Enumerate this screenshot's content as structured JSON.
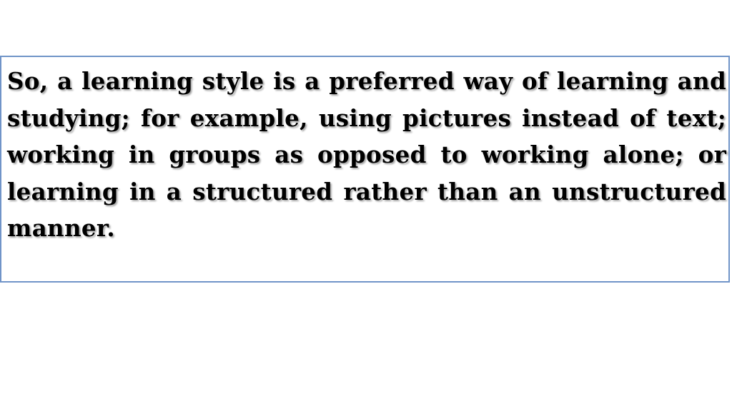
{
  "slide": {
    "paragraph": "So, a learning style is a preferred way of learning and studying; for example, using pictures instead of text; working in groups as opposed to working alone; or learning in a structured rather than an unstructured manner."
  }
}
